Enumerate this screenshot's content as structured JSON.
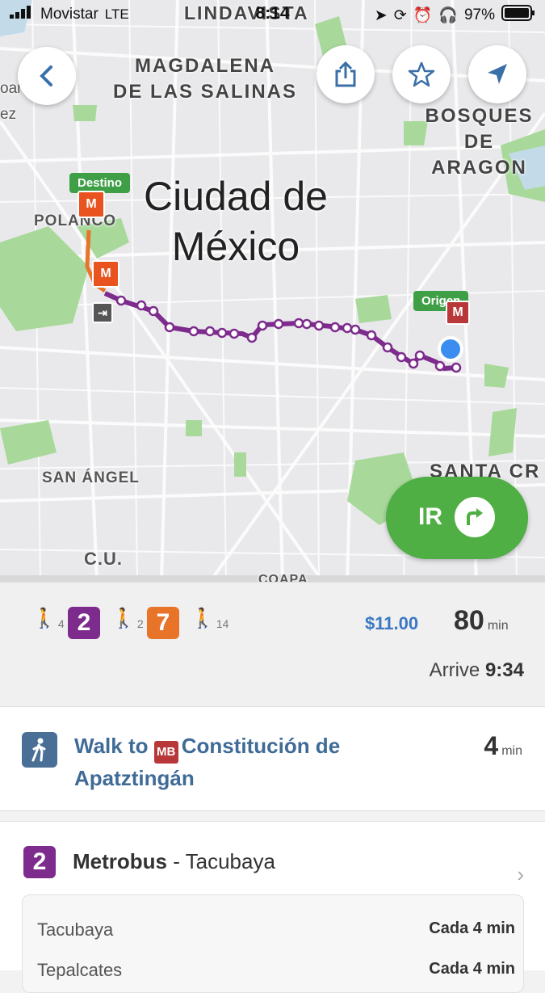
{
  "status_bar": {
    "carrier": "Movistar",
    "network": "LTE",
    "time": "8:14",
    "battery": "97%"
  },
  "map": {
    "labels": {
      "lindavista": "LINDAVISTA",
      "magdalena": "MAGDALENA\nDE LAS SALINAS",
      "bosques": "BOSQUES\nDE ARAGON",
      "polanco": "POLANCO",
      "san_angel": "SAN ÁNGEL",
      "santa_cruz": "SANTA CR",
      "cu": "C.U.",
      "coapa": "COAPA",
      "city": "Ciudad de\nMéxico",
      "left_edge": "oar\nez"
    },
    "destination_pin": "Destino",
    "origin_pin": "Origen",
    "metro_symbol": "M",
    "go_button": "IR"
  },
  "summary": {
    "legs": [
      {
        "type": "walk",
        "minutes": "4"
      },
      {
        "type": "line",
        "label": "2",
        "color": "#7d2b8c"
      },
      {
        "type": "walk",
        "minutes": "2"
      },
      {
        "type": "line",
        "label": "7",
        "color": "#e8742a"
      },
      {
        "type": "walk",
        "minutes": "14"
      }
    ],
    "price": "$11.00",
    "duration": "80",
    "duration_unit": "min",
    "arrive_label": "Arrive",
    "arrive_time": "9:34"
  },
  "step_walk": {
    "text_prefix": "Walk to",
    "station_symbol": "MB",
    "station": "Constitución de Apatztingán",
    "duration": "4",
    "unit": "min"
  },
  "step_metrobus": {
    "line_badge": "2",
    "mode": "Metrobus",
    "separator": " - ",
    "direction": "Tacubaya",
    "stops": [
      {
        "name": "Tacubaya",
        "frequency": "Cada 4 min"
      },
      {
        "name": "Tepalcates",
        "frequency": "Cada 4 min"
      }
    ]
  }
}
